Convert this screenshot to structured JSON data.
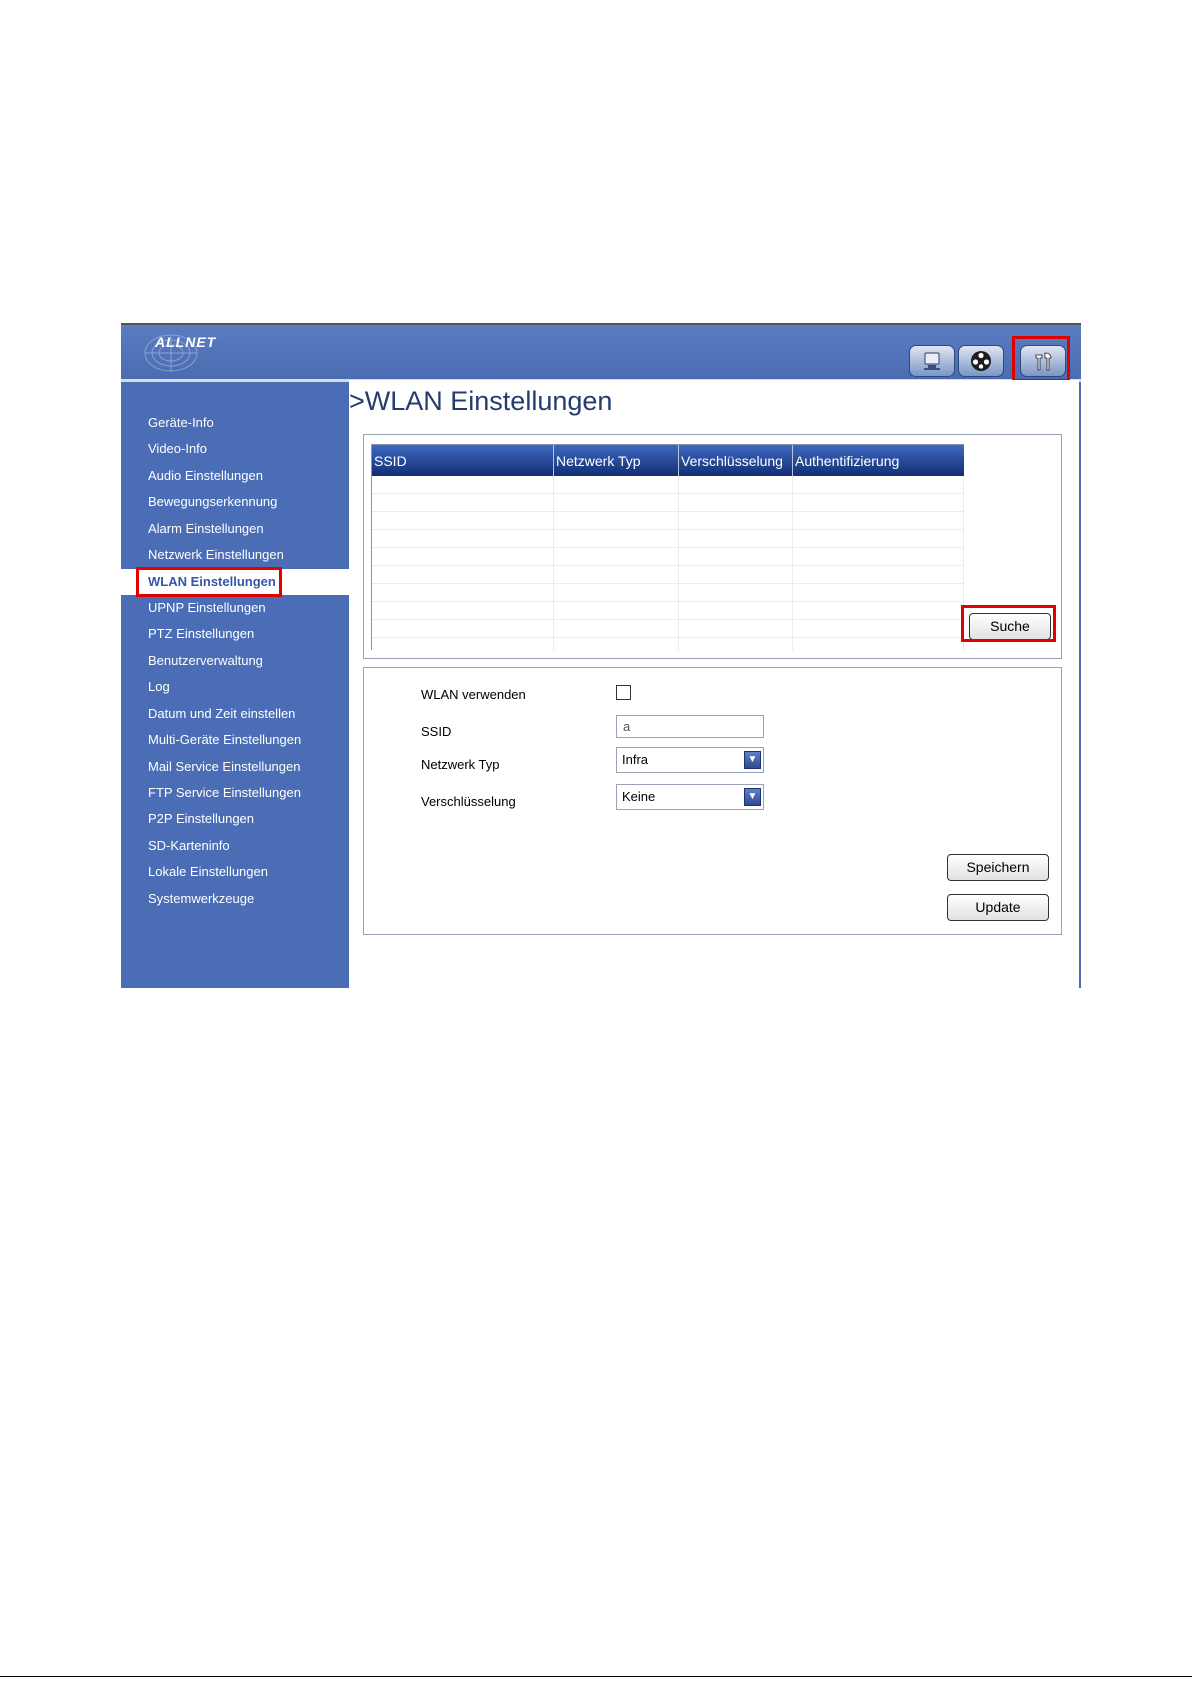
{
  "header": {
    "logo_text": "ALLNET",
    "buttons": [
      {
        "icon": "live-view-icon"
      },
      {
        "icon": "playback-icon"
      },
      {
        "icon": "settings-tools-icon"
      }
    ]
  },
  "sidebar": {
    "items": [
      {
        "label": "Geräte-Info"
      },
      {
        "label": "Video-Info"
      },
      {
        "label": "Audio Einstellungen"
      },
      {
        "label": "Bewegungserkennung"
      },
      {
        "label": "Alarm Einstellungen"
      },
      {
        "label": "Netzwerk Einstellungen"
      },
      {
        "label": "WLAN Einstellungen"
      },
      {
        "label": "UPNP Einstellungen"
      },
      {
        "label": "PTZ Einstellungen"
      },
      {
        "label": "Benutzerverwaltung"
      },
      {
        "label": "Log"
      },
      {
        "label": "Datum und Zeit einstellen"
      },
      {
        "label": "Multi-Geräte Einstellungen"
      },
      {
        "label": "Mail Service Einstellungen"
      },
      {
        "label": "FTP Service Einstellungen"
      },
      {
        "label": "P2P Einstellungen"
      },
      {
        "label": "SD-Karteninfo"
      },
      {
        "label": "Lokale Einstellungen"
      },
      {
        "label": "Systemwerkzeuge"
      }
    ],
    "active": "WLAN Einstellungen"
  },
  "main": {
    "title": ">WLAN Einstellungen",
    "scan_table": {
      "columns": [
        "SSID",
        "Netzwerk Typ",
        "Verschlüsselung",
        "Authentifizierung"
      ],
      "rows": []
    },
    "search_button": "Suche",
    "form": {
      "wlan_enable_label": "WLAN verwenden",
      "wlan_enabled": false,
      "ssid_label": "SSID",
      "ssid_value": "a",
      "network_type_label": "Netzwerk Typ",
      "network_type_value": "Infra",
      "encryption_label": "Verschlüsselung",
      "encryption_value": "Keine"
    },
    "save_button": "Speichern",
    "update_button": "Update"
  },
  "colors": {
    "sidebar_bg": "#4a6db5",
    "table_header": "#1f3f8a",
    "highlight": "#e10000"
  }
}
